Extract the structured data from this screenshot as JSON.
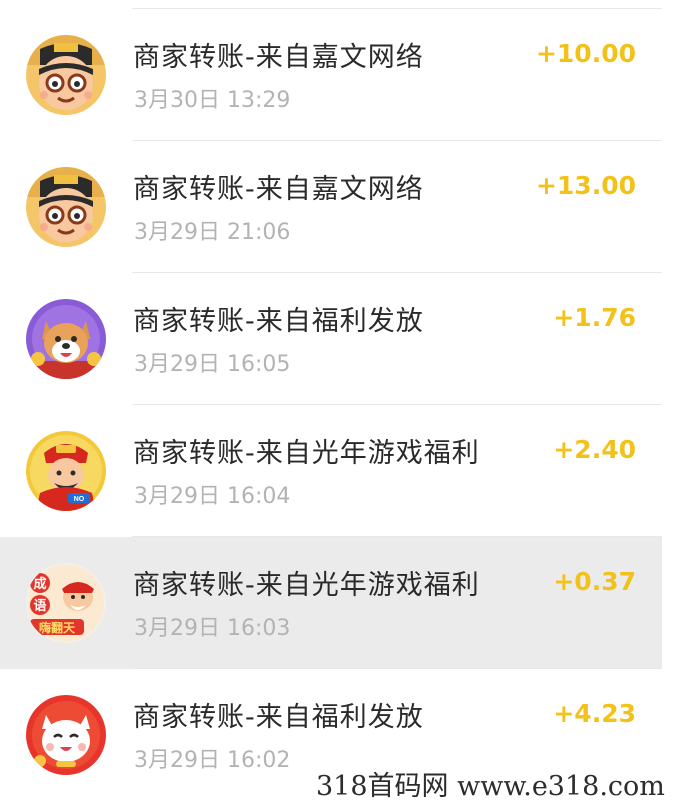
{
  "transactions": [
    {
      "title": "商家转账-来自嘉文网络",
      "time": "3月30日 13:29",
      "amount": "+10.00",
      "avatar": "cartoon-man-avatar-icon",
      "highlighted": false
    },
    {
      "title": "商家转账-来自嘉文网络",
      "time": "3月29日 21:06",
      "amount": "+13.00",
      "avatar": "cartoon-man-avatar-icon",
      "highlighted": false
    },
    {
      "title": "商家转账-来自福利发放",
      "time": "3月29日 16:05",
      "amount": "+1.76",
      "avatar": "shiba-dog-avatar-icon",
      "highlighted": false
    },
    {
      "title": "商家转账-来自光年游戏福利",
      "time": "3月29日 16:04",
      "amount": "+2.40",
      "avatar": "god-of-wealth-avatar-icon",
      "highlighted": false
    },
    {
      "title": "商家转账-来自光年游戏福利",
      "time": "3月29日 16:03",
      "amount": "+0.37",
      "avatar": "idiom-game-avatar-icon",
      "avatar_text": [
        "成",
        "语",
        "嗨翻天"
      ],
      "highlighted": true
    },
    {
      "title": "商家转账-来自福利发放",
      "time": "3月29日 16:02",
      "amount": "+4.23",
      "avatar": "lucky-cat-avatar-icon",
      "highlighted": false
    }
  ],
  "watermark": "318首码网  www.e318.com",
  "colors": {
    "amount": "#f2c21b",
    "title": "#2a2a2a",
    "time": "#b3b3b3",
    "highlight_row": "#ebebeb",
    "divider": "#e8e8e8"
  }
}
